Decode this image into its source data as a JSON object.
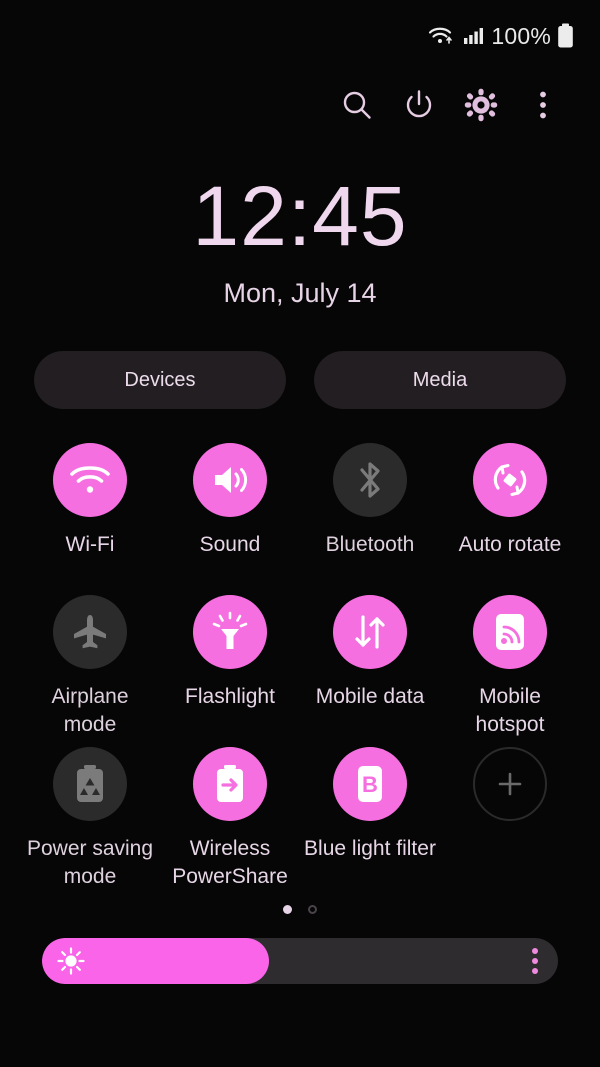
{
  "status_bar": {
    "wifi_icon": "wifi-data-icon",
    "signal_icon": "cellular-signal-icon",
    "battery_percent": "100%",
    "battery_icon": "battery-full-icon"
  },
  "action_bar": {
    "items": [
      {
        "name": "search-icon",
        "label": "Search"
      },
      {
        "name": "power-icon",
        "label": "Power"
      },
      {
        "name": "settings-gear-icon",
        "label": "Settings"
      },
      {
        "name": "more-options-icon",
        "label": "More options"
      }
    ]
  },
  "clock": {
    "time": "12:45",
    "date": "Mon, July 14"
  },
  "chips": [
    {
      "label": "Devices"
    },
    {
      "label": "Media"
    }
  ],
  "tiles": [
    {
      "label": "Wi-Fi",
      "icon": "wifi-icon",
      "state": "on"
    },
    {
      "label": "Sound",
      "icon": "sound-icon",
      "state": "on"
    },
    {
      "label": "Bluetooth",
      "icon": "bluetooth-icon",
      "state": "off"
    },
    {
      "label": "Auto rotate",
      "icon": "auto-rotate-icon",
      "state": "on"
    },
    {
      "label": "Airplane mode",
      "icon": "airplane-icon",
      "state": "off"
    },
    {
      "label": "Flashlight",
      "icon": "flashlight-icon",
      "state": "on"
    },
    {
      "label": "Mobile data",
      "icon": "mobile-data-icon",
      "state": "on"
    },
    {
      "label": "Mobile hotspot",
      "icon": "hotspot-icon",
      "state": "on"
    },
    {
      "label": "Power saving mode",
      "icon": "power-saving-icon",
      "state": "off"
    },
    {
      "label": "Wireless PowerShare",
      "icon": "powershare-icon",
      "state": "on"
    },
    {
      "label": "Blue light filter",
      "icon": "blue-light-icon",
      "state": "on"
    },
    {
      "label": "",
      "icon": "add-tile-icon",
      "state": "add"
    }
  ],
  "page_indicator": {
    "total": 2,
    "active": 1
  },
  "brightness": {
    "value_percent": 44,
    "sun_icon": "brightness-sun-icon",
    "menu_icon": "brightness-options-icon"
  },
  "colors": {
    "accent_on": "#f56fe0",
    "slider_fill": "#f964e8",
    "tile_off": "#2b2b2b",
    "label_text": "#e6d6e6",
    "background": "#060606"
  }
}
